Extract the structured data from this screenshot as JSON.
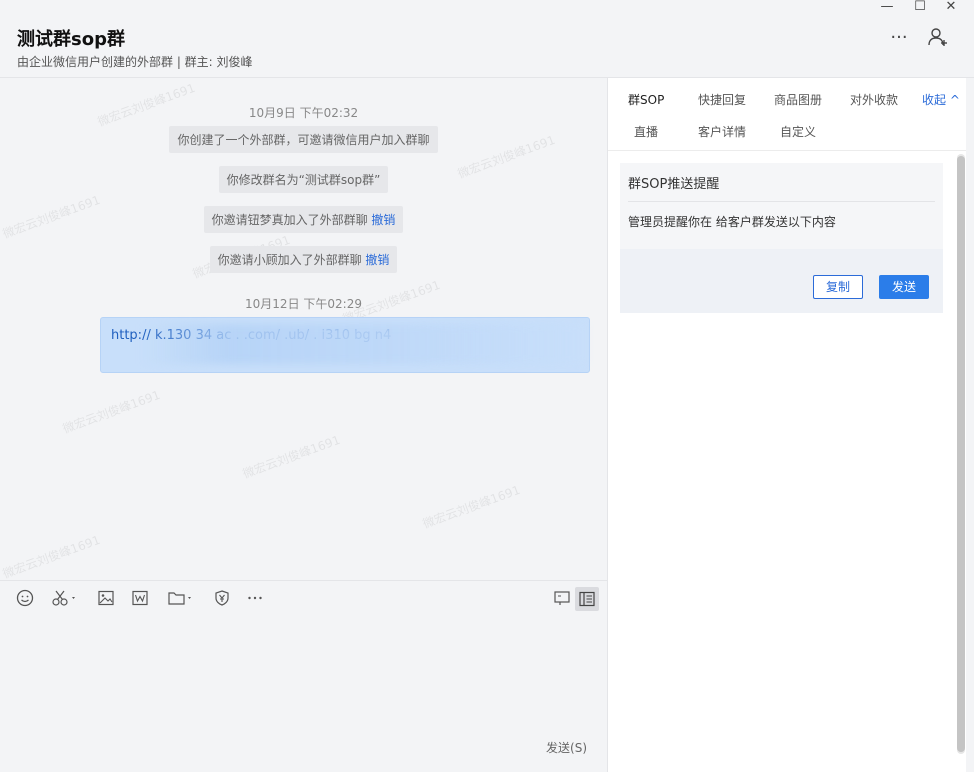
{
  "header": {
    "title": "测试群sop群",
    "subtitle": "由企业微信用户创建的外部群 | 群主: 刘俊峰",
    "more_label": "···"
  },
  "window": {
    "minimize": "—",
    "maximize": "☐",
    "close": "✕"
  },
  "chat": {
    "watermark": "微宏云刘俊峰1691",
    "ts1": "10月9日 下午02:32",
    "ts2": "10月12日 下午02:29",
    "msgs": [
      {
        "text": "你创建了一个外部群，可邀请微信用户加入群聊"
      },
      {
        "text": "你修改群名为“测试群sop群”"
      },
      {
        "text": "你邀请钮梦真加入了外部群聊",
        "link": "撤销"
      },
      {
        "text": "你邀请小顾加入了外部群聊",
        "link": "撤销"
      }
    ],
    "link_message": "http://     k.130     34   ac     .       .com/     .ub/  .  i310     bg     n4"
  },
  "composer": {
    "send_label": "发送(S)"
  },
  "panel": {
    "tabs": [
      "群SOP",
      "快捷回复",
      "商品图册",
      "对外收款",
      "直播",
      "客户详情",
      "自定义"
    ],
    "collapse_label": "收起 ^",
    "sop": {
      "title": "群SOP推送提醒",
      "text": "管理员提醒你在  给客户群发送以下内容",
      "copy_label": "复制",
      "send_label": "发送"
    }
  }
}
